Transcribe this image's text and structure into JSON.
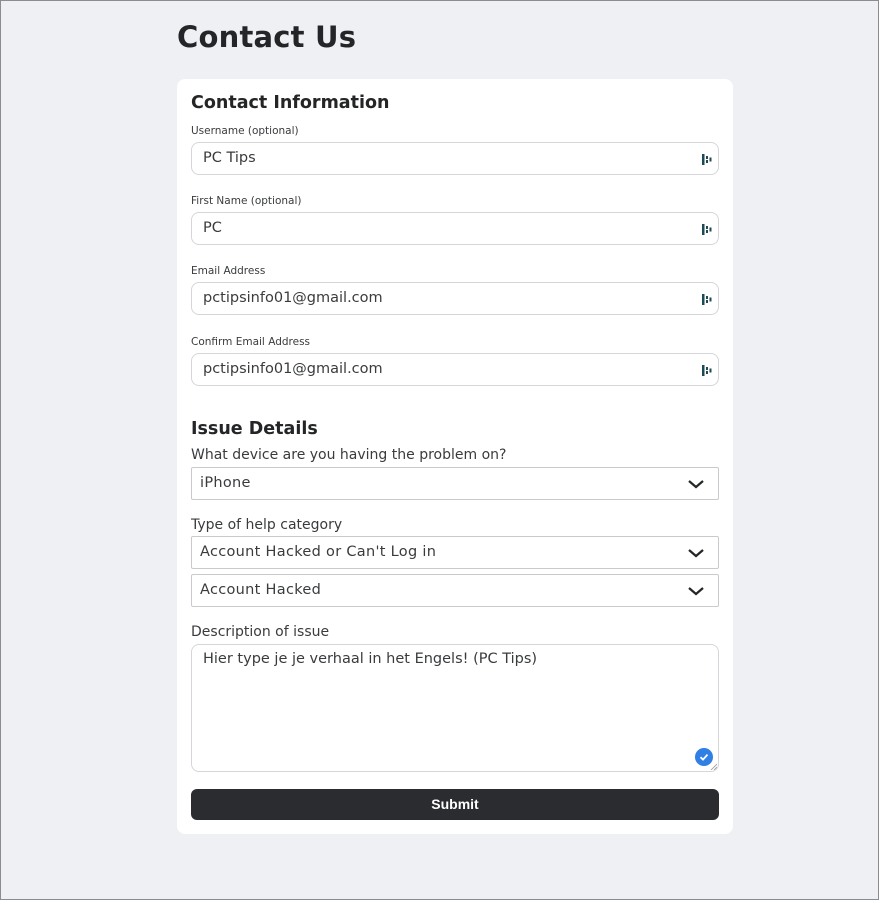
{
  "page": {
    "title": "Contact Us"
  },
  "contact_info": {
    "heading": "Contact Information",
    "fields": [
      {
        "label": "Username (optional)",
        "value": "PC Tips",
        "icon": "password-manager-icon"
      },
      {
        "label": "First Name (optional)",
        "value": "PC",
        "icon": "password-manager-icon"
      },
      {
        "label": "Email Address",
        "value": "pctipsinfo01@gmail.com",
        "icon": "password-manager-icon"
      },
      {
        "label": "Confirm Email Address",
        "value": "pctipsinfo01@gmail.com",
        "icon": "password-manager-icon"
      }
    ]
  },
  "issue_details": {
    "heading": "Issue Details",
    "device_label": "What device are you having the problem on?",
    "device_value": "iPhone",
    "category_label": "Type of help category",
    "category_value": "Account Hacked or Can't Log in",
    "subcategory_value": "Account Hacked",
    "description_label": "Description of issue",
    "description_value": "Hier type je je verhaal in het Engels! (PC Tips)"
  },
  "actions": {
    "submit_label": "Submit"
  },
  "colors": {
    "background": "#eff0f4",
    "card": "#ffffff",
    "submit_bg": "#2b2c30",
    "check_badge": "#2f7fe5",
    "pm_icon": "#1e4a55"
  }
}
